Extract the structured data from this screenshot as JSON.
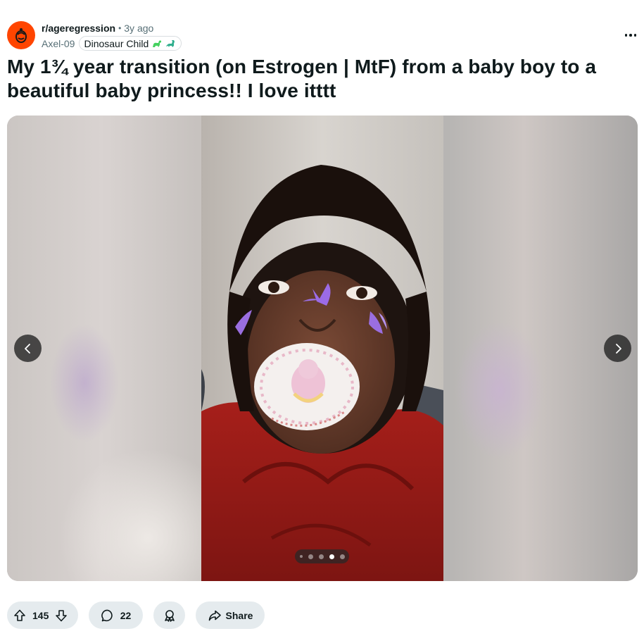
{
  "post": {
    "subreddit": "r/ageregression",
    "separator": "•",
    "time_ago": "3y ago",
    "author": "Axel-09",
    "flair": "Dinosaur Child",
    "title": "My 1¾ year transition (on Estrogen | MtF) from a baby boy to a beautiful baby princess!! I love itttt"
  },
  "gallery": {
    "current_index": 4,
    "total": 5,
    "prev_icon": "chevron-left-icon",
    "next_icon": "chevron-right-icon"
  },
  "actions": {
    "score": "145",
    "comments": "22",
    "share_label": "Share"
  },
  "colors": {
    "subreddit_accent": "#ff4500",
    "pill_background": "#e5ebee",
    "text_primary": "#0f1a1c",
    "text_muted": "#576f76",
    "flair_dino": "#46d160"
  }
}
